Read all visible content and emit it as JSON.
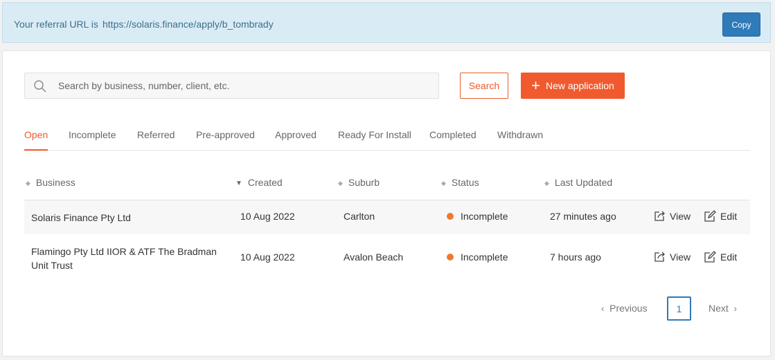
{
  "referral": {
    "label": "Your referral URL is",
    "url": "https://solaris.finance/apply/b_tombrady",
    "copy_label": "Copy"
  },
  "search": {
    "placeholder": "Search by business, number, client, etc.",
    "value": "",
    "button_label": "Search",
    "icon": "search-icon"
  },
  "new_application": {
    "label": "New application",
    "icon": "plus-icon"
  },
  "tabs": [
    {
      "label": "Open",
      "active": true
    },
    {
      "label": "Incomplete"
    },
    {
      "label": "Referred"
    },
    {
      "label": "Pre-approved"
    },
    {
      "label": "Approved"
    },
    {
      "label": "Ready For Install"
    },
    {
      "label": "Completed"
    },
    {
      "label": "Withdrawn"
    }
  ],
  "table": {
    "columns": [
      "Business",
      "Created",
      "Suburb",
      "Status",
      "Last Updated"
    ],
    "sorted_column": "Created",
    "rows": [
      {
        "business": "Solaris Finance Pty Ltd",
        "created": "10 Aug 2022",
        "suburb": "Carlton",
        "status": "Incomplete",
        "last_updated": "27 minutes ago"
      },
      {
        "business": "Flamingo Pty Ltd IIOR & ATF The Bradman Unit Trust",
        "created": "10 Aug 2022",
        "suburb": "Avalon Beach",
        "status": "Incomplete",
        "last_updated": "7 hours ago"
      }
    ],
    "actions": {
      "view": "View",
      "edit": "Edit"
    }
  },
  "pagination": {
    "previous": "Previous",
    "current_page": "1",
    "next": "Next"
  },
  "colors": {
    "accent": "#f05a2e",
    "primary": "#2f7ab9",
    "status_incomplete": "#f07a2c",
    "referral_bg": "#d9ecf5"
  }
}
